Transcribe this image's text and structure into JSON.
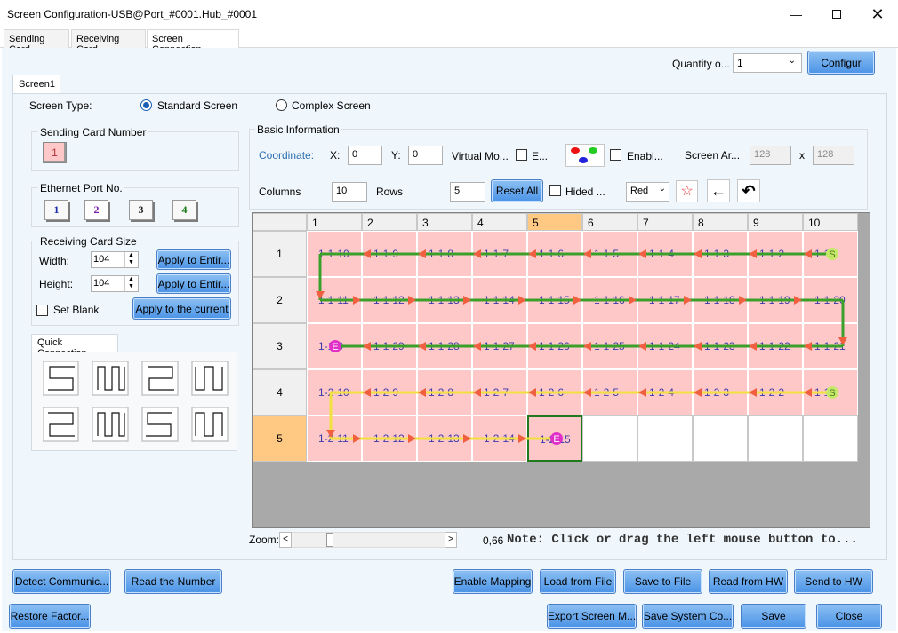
{
  "window": {
    "title": "Screen Configuration-USB@Port_#0001.Hub_#0001"
  },
  "tabs": [
    {
      "label": "Sending Card"
    },
    {
      "label": "Receiving Card"
    },
    {
      "label": "Screen Connection"
    }
  ],
  "quantity": {
    "label": "Quantity o...",
    "value": "1",
    "button": "Configur"
  },
  "screen_tab": "Screen1",
  "screen_type": {
    "label": "Screen Type:",
    "standard": "Standard Screen",
    "complex": "Complex Screen",
    "selected": "standard"
  },
  "sending_card": {
    "label": "Sending Card Number",
    "value": "1"
  },
  "ethernet": {
    "label": "Ethernet Port No.",
    "ports": [
      "1",
      "2",
      "3",
      "4"
    ],
    "selected": "2",
    "colors": [
      "#1a2aa8",
      "#7a1aa8",
      "#222222",
      "#1a7a1a"
    ]
  },
  "receiving_size": {
    "label": "Receiving Card Size",
    "width_label": "Width:",
    "width": "104",
    "height_label": "Height:",
    "height": "104",
    "apply_width": "Apply to Entir...",
    "apply_height": "Apply to Entir...",
    "set_blank": "Set Blank",
    "apply_current": "Apply to the current"
  },
  "quick": {
    "label": "Quick Connection"
  },
  "basic": {
    "label": "Basic Information",
    "coordinate": "Coordinate:",
    "x_label": "X:",
    "x": "0",
    "y_label": "Y:",
    "y": "0",
    "virtual": "Virtual Mo...",
    "e": "E...",
    "enable": "Enabl...",
    "screen_area": "Screen Ar...",
    "area_w": "128",
    "area_x": "x",
    "area_h": "128",
    "columns_label": "Columns",
    "columns": "10",
    "rows_label": "Rows",
    "rows": "5",
    "reset": "Reset All",
    "hided": "Hided ...",
    "color": "Red"
  },
  "grid": {
    "col_headers": [
      "1",
      "2",
      "3",
      "4",
      "5",
      "6",
      "7",
      "8",
      "9",
      "10"
    ],
    "row_headers": [
      "1",
      "2",
      "3",
      "4",
      "5"
    ],
    "selected_col": "5",
    "selected_row": "5",
    "cells": [
      [
        "1-1-10",
        "1-1-9",
        "1-1-8",
        "1-1-7",
        "1-1-6",
        "1-1-5",
        "1-1-4",
        "1-1-3",
        "1-1-2",
        "1-1"
      ],
      [
        "1-1-11",
        "1-1-12",
        "1-1-13",
        "1-1-14",
        "1-1-15",
        "1-1-16",
        "1-1-17",
        "1-1-18",
        "1-1-19",
        "1-1-20"
      ],
      [
        "1-1-0",
        "1-1-29",
        "1-1-28",
        "1-1-27",
        "1-1-26",
        "1-1-25",
        "1-1-24",
        "1-1-23",
        "1-1-22",
        "1-1-21"
      ],
      [
        "1-2-10",
        "1-2-9",
        "1-2-8",
        "1-2-7",
        "1-2-6",
        "1-2-5",
        "1-2-4",
        "1-2-3",
        "1-2-2",
        "1-1"
      ],
      [
        "1-2-11",
        "1-2-12",
        "1-2-13",
        "1-2-14",
        "1-2-15",
        "",
        "",
        "",
        "",
        ""
      ]
    ],
    "start_marker": "S",
    "end_marker": "E"
  },
  "zoom": {
    "label": "Zoom:",
    "left": "<",
    "right": ">",
    "value": "0,66",
    "note": "Note: Click or drag the left mouse button to..."
  },
  "buttons_row1": {
    "detect": "Detect Communic...",
    "read_number": "Read the Number",
    "enable_mapping": "Enable Mapping",
    "load_file": "Load from File",
    "save_file": "Save to File",
    "read_hw": "Read from HW",
    "send_hw": "Send to HW"
  },
  "buttons_row2": {
    "restore": "Restore Factor...",
    "export": "Export Screen M...",
    "save_system": "Save System Co...",
    "save": "Save",
    "close": "Close"
  }
}
